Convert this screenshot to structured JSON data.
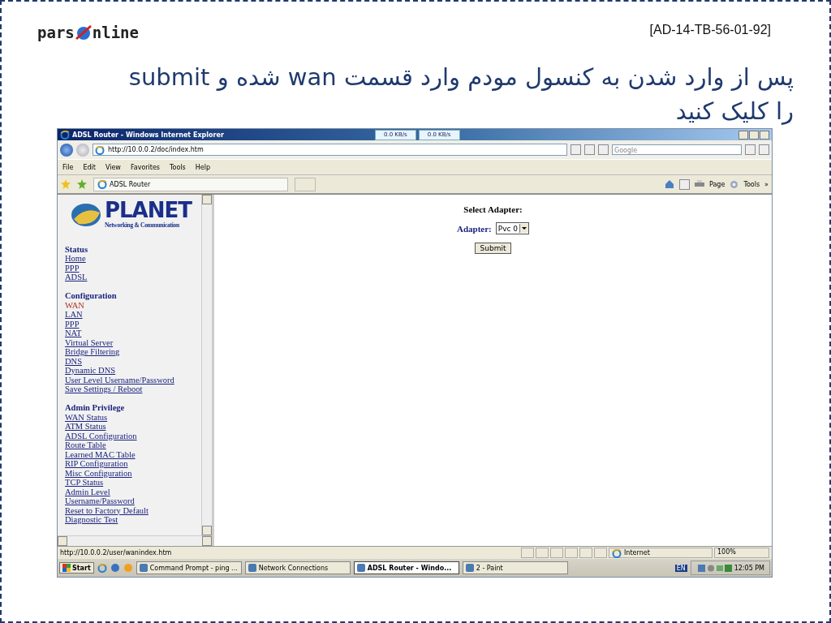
{
  "slide": {
    "logo": {
      "left": "pars",
      "right": "nline"
    },
    "code": "[AD-14-TB-56-01-92]",
    "heading": "پس از وارد شدن به کنسول مودم وارد قسمت wan شده و submit را کلیک کنید"
  },
  "browser": {
    "title": "ADSL Router - Windows Internet Explorer",
    "speeds": [
      "0.0 KB/s",
      "0.0 KB/s"
    ],
    "address": "http://10.0.0.2/doc/index.htm",
    "search_placeholder": "Google",
    "menu": [
      "File",
      "Edit",
      "View",
      "Favorites",
      "Tools",
      "Help"
    ],
    "tab": "ADSL Router",
    "commands": [
      "Page",
      "Tools"
    ],
    "chevron": "»"
  },
  "sidebar": {
    "logo_name": "PLANET",
    "logo_tagline": "Networking & Communication",
    "groups": [
      {
        "heading": "Status",
        "links": [
          {
            "label": "Home",
            "selected": false
          },
          {
            "label": "PPP",
            "selected": false
          },
          {
            "label": "ADSL",
            "selected": false
          }
        ]
      },
      {
        "heading": "Configuration",
        "links": [
          {
            "label": "WAN",
            "selected": true
          },
          {
            "label": "LAN",
            "selected": false
          },
          {
            "label": "PPP",
            "selected": false
          },
          {
            "label": "NAT",
            "selected": false
          },
          {
            "label": "Virtual Server",
            "selected": false
          },
          {
            "label": "Bridge Filtering",
            "selected": false
          },
          {
            "label": "DNS",
            "selected": false
          },
          {
            "label": "Dynamic DNS",
            "selected": false
          },
          {
            "label": "User Level Username/Password",
            "selected": false
          },
          {
            "label": "Save Settings / Reboot",
            "selected": false
          }
        ]
      },
      {
        "heading": "Admin Privilege",
        "links": [
          {
            "label": "WAN Status",
            "selected": false
          },
          {
            "label": "ATM Status",
            "selected": false
          },
          {
            "label": "ADSL Configuration",
            "selected": false
          },
          {
            "label": "Route Table",
            "selected": false
          },
          {
            "label": "Learned MAC Table",
            "selected": false
          },
          {
            "label": "RIP Configuration",
            "selected": false
          },
          {
            "label": "Misc Configuration",
            "selected": false
          },
          {
            "label": "TCP Status",
            "selected": false
          },
          {
            "label": "Admin Level",
            "selected": false
          },
          {
            "label": "Username/Password",
            "selected": false
          },
          {
            "label": "Reset to Factory Default",
            "selected": false
          },
          {
            "label": "Diagnostic Test",
            "selected": false
          }
        ]
      }
    ]
  },
  "main": {
    "title": "Select Adapter:",
    "adapter_label": "Adapter:",
    "adapter_value": "Pvc 0",
    "submit": "Submit"
  },
  "status_bar": {
    "url": "http://10.0.0.2/user/wanindex.htm",
    "zone": "Internet",
    "zoom": "100%"
  },
  "taskbar": {
    "start": "Start",
    "tasks": [
      {
        "label": "Command Prompt - ping ...",
        "selected": false
      },
      {
        "label": "Network Connections",
        "selected": false
      },
      {
        "label": "ADSL Router - Windo...",
        "selected": true
      },
      {
        "label": "2 - Paint",
        "selected": false
      }
    ],
    "language": "EN",
    "time": "12:05 PM"
  }
}
